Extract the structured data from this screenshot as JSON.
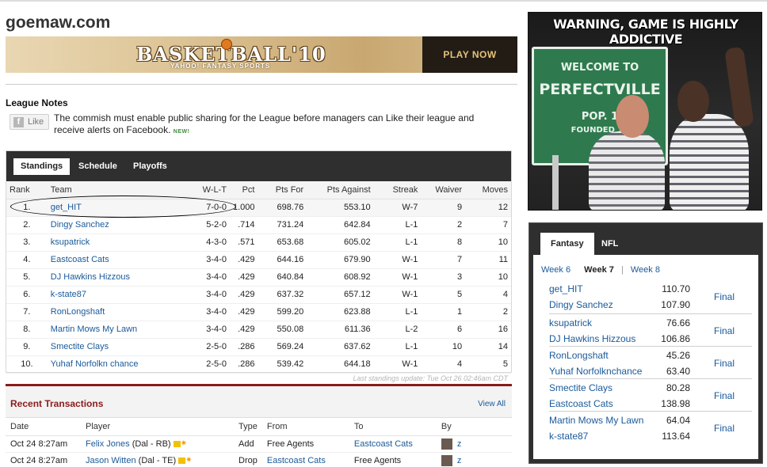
{
  "site": {
    "title": "goemaw.com"
  },
  "banner": {
    "logo": "BASKETBALL'10",
    "subtitle": "YAHOO! FANTASY SPORTS",
    "cta": "PLAY NOW"
  },
  "league_notes": {
    "title": "League Notes",
    "like_label": "Like",
    "fb_glyph": "f",
    "text": "The commish must enable public sharing for the League before managers can Like their league and receive alerts on Facebook.",
    "new_badge": "NEW!"
  },
  "standings": {
    "tabs": [
      "Standings",
      "Schedule",
      "Playoffs"
    ],
    "headers": [
      "Rank",
      "Team",
      "W-L-T",
      "Pct",
      "Pts For",
      "Pts Against",
      "Streak",
      "Waiver",
      "Moves"
    ],
    "rows": [
      [
        "1.",
        "get_HIT",
        "7-0-0",
        "1.000",
        "698.76",
        "553.10",
        "W-7",
        "9",
        "12"
      ],
      [
        "2.",
        "Dingy Sanchez",
        "5-2-0",
        ".714",
        "731.24",
        "642.84",
        "L-1",
        "2",
        "7"
      ],
      [
        "3.",
        "ksupatrick",
        "4-3-0",
        ".571",
        "653.68",
        "605.02",
        "L-1",
        "8",
        "10"
      ],
      [
        "4.",
        "Eastcoast Cats",
        "3-4-0",
        ".429",
        "644.16",
        "679.90",
        "W-1",
        "7",
        "11"
      ],
      [
        "5.",
        "DJ Hawkins Hizzous",
        "3-4-0",
        ".429",
        "640.84",
        "608.92",
        "W-1",
        "3",
        "10"
      ],
      [
        "6.",
        "k-state87",
        "3-4-0",
        ".429",
        "637.32",
        "657.12",
        "W-1",
        "5",
        "4"
      ],
      [
        "7.",
        "RonLongshaft",
        "3-4-0",
        ".429",
        "599.20",
        "623.88",
        "L-1",
        "1",
        "2"
      ],
      [
        "8.",
        "Martin Mows My Lawn",
        "3-4-0",
        ".429",
        "550.08",
        "611.36",
        "L-2",
        "6",
        "16"
      ],
      [
        "9.",
        "Smectite Clays",
        "2-5-0",
        ".286",
        "569.24",
        "637.62",
        "L-1",
        "10",
        "14"
      ],
      [
        "10.",
        "Yuhaf Norfolkn chance",
        "2-5-0",
        ".286",
        "539.42",
        "644.18",
        "W-1",
        "4",
        "5"
      ]
    ],
    "last_update": "Last standings update: Tue Oct 26 02:46am CDT"
  },
  "transactions": {
    "title": "Recent Transactions",
    "view_all": "View All",
    "headers": [
      "Date",
      "Player",
      "Type",
      "From",
      "To",
      "By"
    ],
    "rows": [
      {
        "date": "Oct 24 8:27am",
        "player": "Felix Jones",
        "pos": "(Dal - RB)",
        "type": "Add",
        "from": "Free Agents",
        "to": "Eastcoast Cats",
        "by": "z"
      },
      {
        "date": "Oct 24 8:27am",
        "player": "Jason Witten",
        "pos": "(Dal - TE)",
        "type": "Drop",
        "from": "Eastcoast Cats",
        "to": "Free Agents",
        "by": "z"
      }
    ]
  },
  "ad": {
    "headline": "WARNING, GAME IS HIGHLY ADDICTIVE",
    "sign_line1": "WELCOME TO",
    "sign_line2": "PERFECTVILLE",
    "sign_line3": "POP. 1",
    "sign_line4": "FOUNDED 19"
  },
  "scoreboard": {
    "tabs": [
      "Fantasy",
      "NFL"
    ],
    "weeks": {
      "prev": "Week 6",
      "current": "Week 7",
      "next": "Week 8"
    },
    "matchups": [
      {
        "t1": "get_HIT",
        "s1": "110.70",
        "t2": "Dingy Sanchez",
        "s2": "107.90",
        "status": "Final"
      },
      {
        "t1": "ksupatrick",
        "s1": "76.66",
        "t2": "DJ Hawkins Hizzous",
        "s2": "106.86",
        "status": "Final"
      },
      {
        "t1": "RonLongshaft",
        "s1": "45.26",
        "t2": "Yuhaf Norfolknchance",
        "s2": "63.40",
        "status": "Final"
      },
      {
        "t1": "Smectite Clays",
        "s1": "80.28",
        "t2": "Eastcoast Cats",
        "s2": "138.98",
        "status": "Final"
      },
      {
        "t1": "Martin Mows My Lawn",
        "s1": "64.04",
        "t2": "k-state87",
        "s2": "113.64",
        "status": "Final"
      }
    ]
  },
  "colors": {
    "accent_link": "#1a5a9a",
    "dark_bar": "#2f2f2f",
    "transactions_red": "#8a1c1c"
  }
}
